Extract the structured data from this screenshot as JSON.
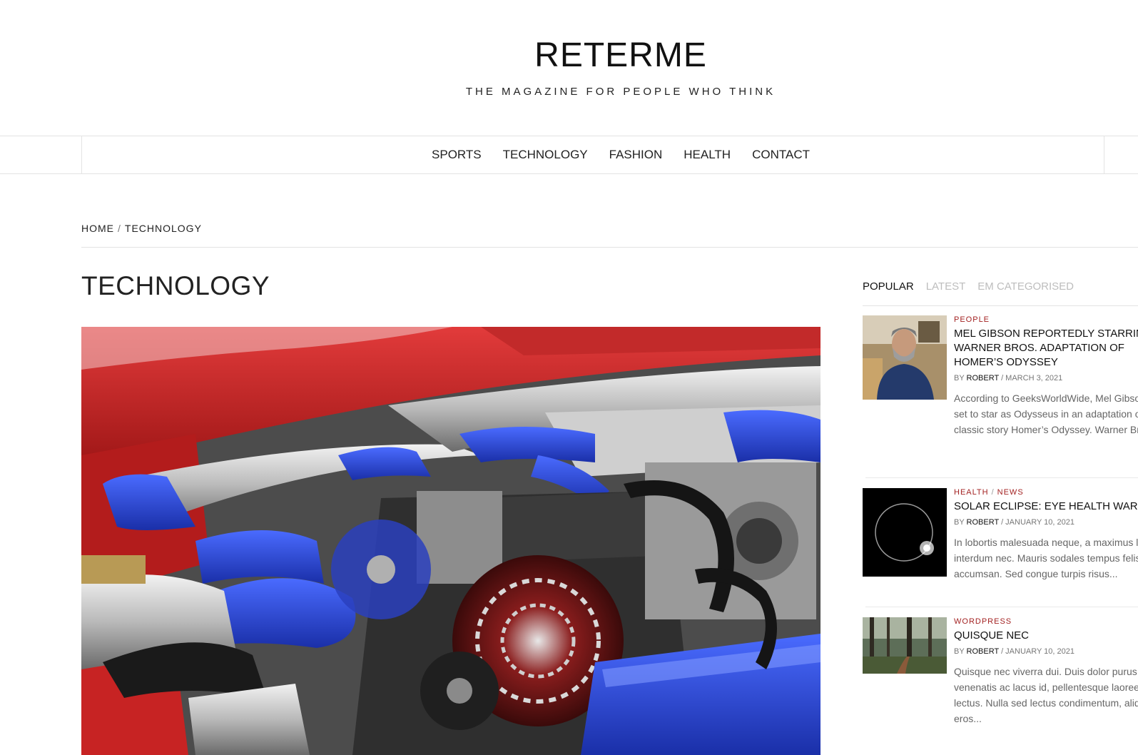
{
  "site": {
    "title": "RETERME",
    "tagline": "THE MAGAZINE FOR PEOPLE WHO THINK"
  },
  "nav": {
    "items": [
      {
        "label": "SPORTS"
      },
      {
        "label": "TECHNOLOGY"
      },
      {
        "label": "FASHION"
      },
      {
        "label": "HEALTH"
      },
      {
        "label": "CONTACT"
      }
    ]
  },
  "breadcrumb": {
    "home": "HOME",
    "separator": "/",
    "current": "TECHNOLOGY"
  },
  "main": {
    "page_title": "TECHNOLOGY",
    "featured_image_icon": "engine-photo"
  },
  "sidebar": {
    "tabs": [
      {
        "label": "POPULAR"
      },
      {
        "label": "LATEST"
      },
      {
        "label": "EM CATEGORISED"
      }
    ],
    "posts": [
      {
        "categories": [
          "PEOPLE"
        ],
        "title": "MEL GIBSON REPORTEDLY STARRING IN WARNER BROS. ADAPTATION OF HOMER’S ODYSSEY",
        "by": "BY",
        "author": "ROBERT",
        "date": "/ MARCH 3, 2021",
        "excerpt": "According to GeeksWorldWide, Mel Gibson is set to star as Odysseus in an adaptation of the classic story Homer’s Odyssey. Warner Bros....",
        "thumb_icon": "portrait-photo"
      },
      {
        "categories": [
          "HEALTH",
          "NEWS"
        ],
        "title": "SOLAR ECLIPSE: EYE HEALTH WARNING",
        "by": "BY",
        "author": "ROBERT",
        "date": "/ JANUARY 10, 2021",
        "excerpt": "In lobortis malesuada neque, a maximus leo interdum nec. Mauris sodales tempus felis, non accumsan. Sed congue turpis risus...",
        "thumb_icon": "eclipse-photo"
      },
      {
        "categories": [
          "WORDPRESS"
        ],
        "title": "QUISQUE NEC",
        "by": "BY",
        "author": "ROBERT",
        "date": "/ JANUARY 10, 2021",
        "excerpt": "Quisque nec viverra dui. Duis dolor purus, venenatis ac lacus id, pellentesque laoreet lectus. Nulla sed lectus condimentum, aliquam eros...",
        "thumb_icon": "forest-photo"
      }
    ]
  },
  "colors": {
    "accent": "#a32222",
    "text": "#222222",
    "muted": "#bdbdbd",
    "divider": "#e3e3e3"
  }
}
